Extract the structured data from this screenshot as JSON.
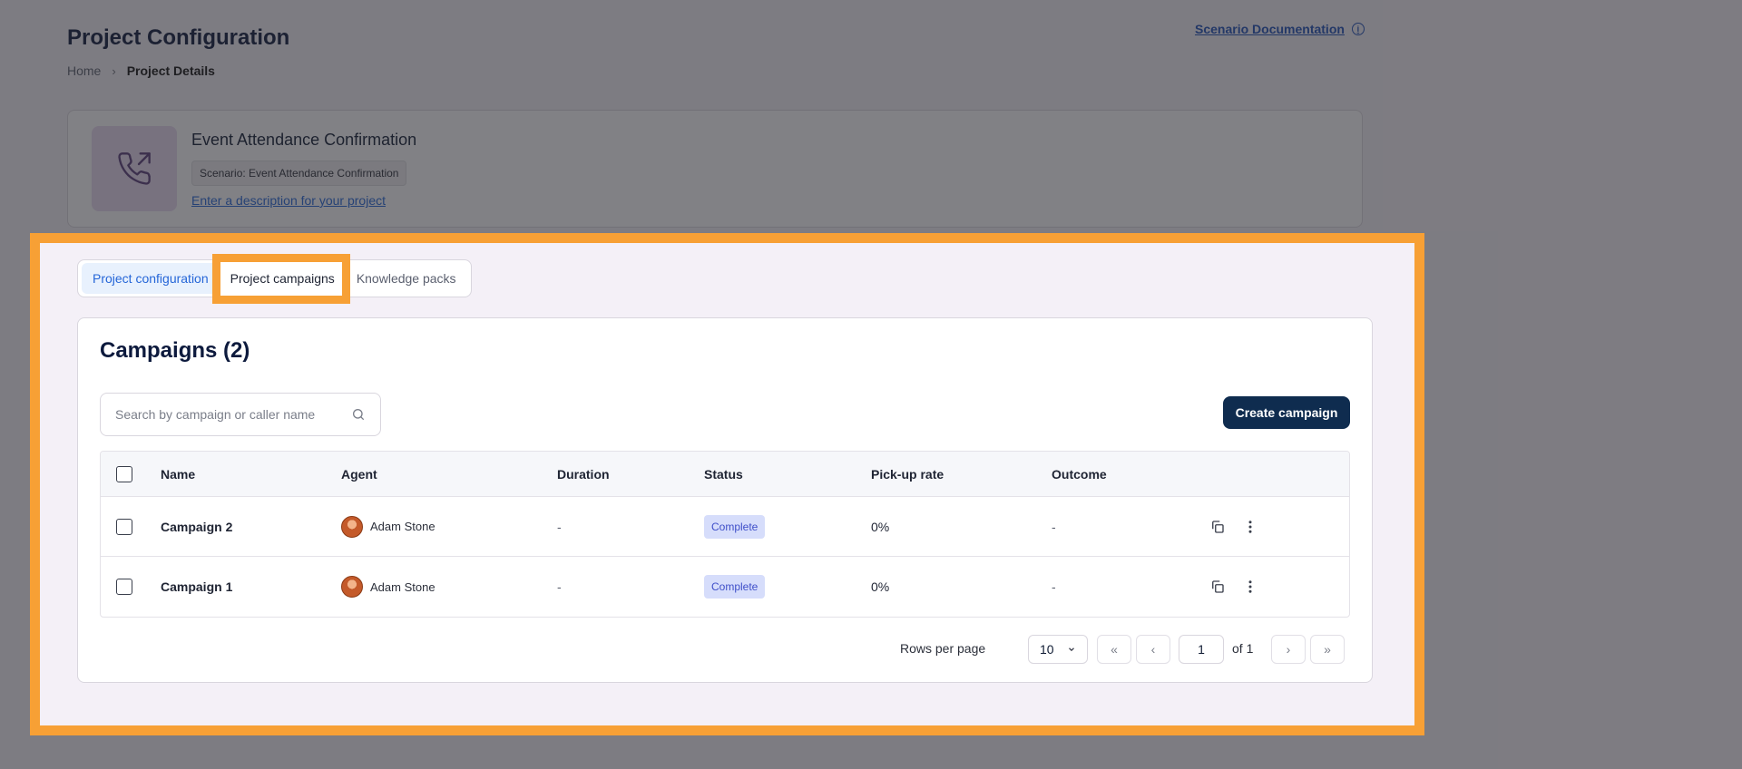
{
  "header": {
    "title": "Project Configuration",
    "breadcrumb": {
      "home": "Home",
      "separator": "›",
      "current": "Project Details"
    },
    "doc_link": "Scenario Documentation",
    "info_icon": "i"
  },
  "project": {
    "name": "Event Attendance Confirmation",
    "scenario": "Scenario: Event Attendance Confirmation",
    "description_link": "Enter a description for your project",
    "icon": "phone-outgoing-icon"
  },
  "tabs": [
    {
      "label": "Project configuration",
      "state": "active"
    },
    {
      "label": "Project campaigns",
      "state": "highlighted"
    },
    {
      "label": "Knowledge packs",
      "state": "default"
    }
  ],
  "campaigns": {
    "title": "Campaigns (2)",
    "search_placeholder": "Search by campaign or caller name",
    "create_label": "Create campaign",
    "columns": [
      "Name",
      "Agent",
      "Duration",
      "Status",
      "Pick-up rate",
      "Outcome"
    ],
    "rows": [
      {
        "name": "Campaign 2",
        "agent": "Adam Stone",
        "duration": "-",
        "status": "Complete",
        "pickup": "0%",
        "outcome": "-"
      },
      {
        "name": "Campaign 1",
        "agent": "Adam Stone",
        "duration": "-",
        "status": "Complete",
        "pickup": "0%",
        "outcome": "-"
      }
    ]
  },
  "pagination": {
    "rows_label": "Rows per page",
    "rows_value": "10",
    "first": "«",
    "prev": "‹",
    "page": "1",
    "of_label": "of 1",
    "next": "›",
    "last": "»"
  },
  "colors": {
    "highlight": "#f7a035",
    "primary_button": "#0f2c4f",
    "active_tab": "#2566d8",
    "badge_bg": "#d6ddfb"
  }
}
